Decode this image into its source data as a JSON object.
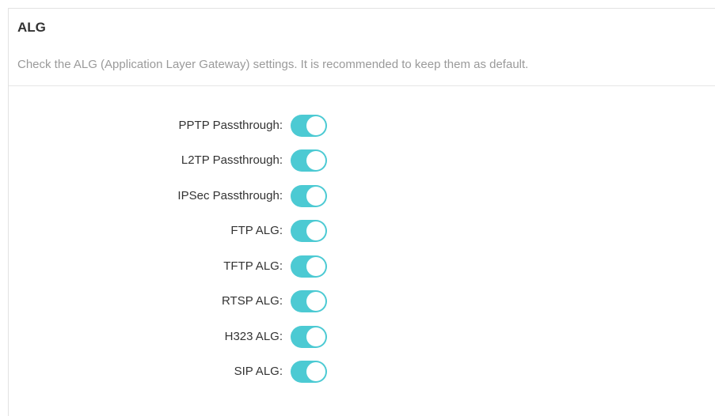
{
  "section": {
    "title": "ALG",
    "description": "Check the ALG (Application Layer Gateway) settings. It is recommended to keep them as default."
  },
  "settings": [
    {
      "label": "PPTP Passthrough:",
      "enabled": true
    },
    {
      "label": "L2TP Passthrough:",
      "enabled": true
    },
    {
      "label": "IPSec Passthrough:",
      "enabled": true
    },
    {
      "label": "FTP ALG:",
      "enabled": true
    },
    {
      "label": "TFTP ALG:",
      "enabled": true
    },
    {
      "label": "RTSP ALG:",
      "enabled": true
    },
    {
      "label": "H323 ALG:",
      "enabled": true
    },
    {
      "label": "SIP ALG:",
      "enabled": true
    }
  ],
  "colors": {
    "toggle_on": "#4ccad3",
    "toggle_off": "#cfcfcf"
  }
}
